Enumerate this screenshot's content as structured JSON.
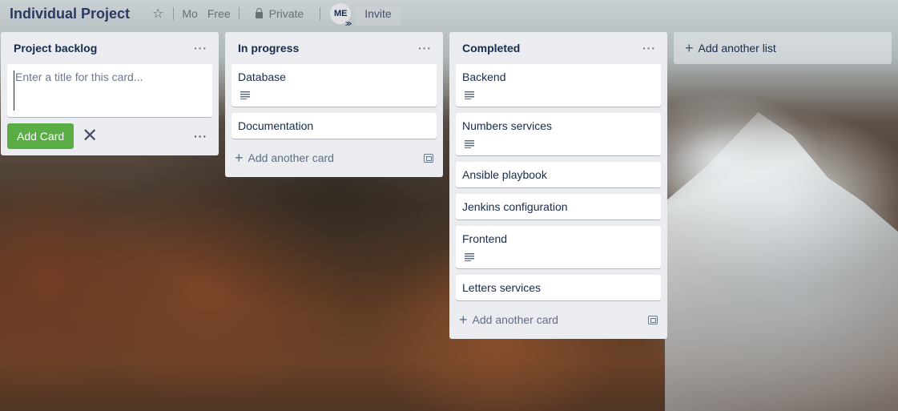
{
  "board": {
    "title": "Individual Project",
    "header_items": [
      "Mo",
      "Free",
      "Private"
    ],
    "member_initials": "ME",
    "invite_label": "Invite"
  },
  "icons": {
    "star": "☆",
    "plus": "+",
    "close": "✕",
    "more": "···",
    "admin_chevron": "≫"
  },
  "lists": [
    {
      "title": "Project backlog",
      "composer": {
        "placeholder": "Enter a title for this card...",
        "add_button_label": "Add Card"
      }
    },
    {
      "title": "In progress",
      "cards": [
        {
          "title": "Database",
          "has_description": true
        },
        {
          "title": "Documentation",
          "has_description": false
        }
      ],
      "add_card_label": "Add another card"
    },
    {
      "title": "Completed",
      "cards": [
        {
          "title": "Backend",
          "has_description": true
        },
        {
          "title": "Numbers services",
          "has_description": true
        },
        {
          "title": "Ansible playbook",
          "has_description": false
        },
        {
          "title": "Jenkins configuration",
          "has_description": false
        },
        {
          "title": "Frontend",
          "has_description": true
        },
        {
          "title": "Letters services",
          "has_description": false
        }
      ],
      "add_card_label": "Add another card"
    }
  ],
  "add_list_label": "Add another list",
  "colors": {
    "list_bg": "#ebecf0",
    "add_button": "#5aac44",
    "text": "#172b4d"
  }
}
